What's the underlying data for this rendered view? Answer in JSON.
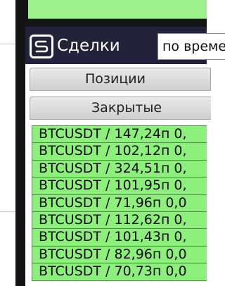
{
  "header": {
    "logo_icon": "s-logo-icon",
    "title": "Сделки",
    "sort_value": "по време"
  },
  "tabs": [
    {
      "label": "Позиции"
    },
    {
      "label": "Закрытые"
    }
  ],
  "trades": [
    "BTCUSDT / 147,24п 0,",
    "BTCUSDT / 102,12п 0,",
    "BTCUSDT / 324,51п 0,",
    "BTCUSDT / 101,95п 0,",
    "BTCUSDT / 71,96п 0,0",
    "BTCUSDT / 112,62п 0,",
    "BTCUSDT / 101,43п 0,",
    "BTCUSDT / 82,96п 0,0",
    "BTCUSDT / 70,73п 0,0"
  ],
  "colors": {
    "row_green": "#8ef07c",
    "banner_green": "#9ef08c",
    "header_bg": "#22223a"
  }
}
